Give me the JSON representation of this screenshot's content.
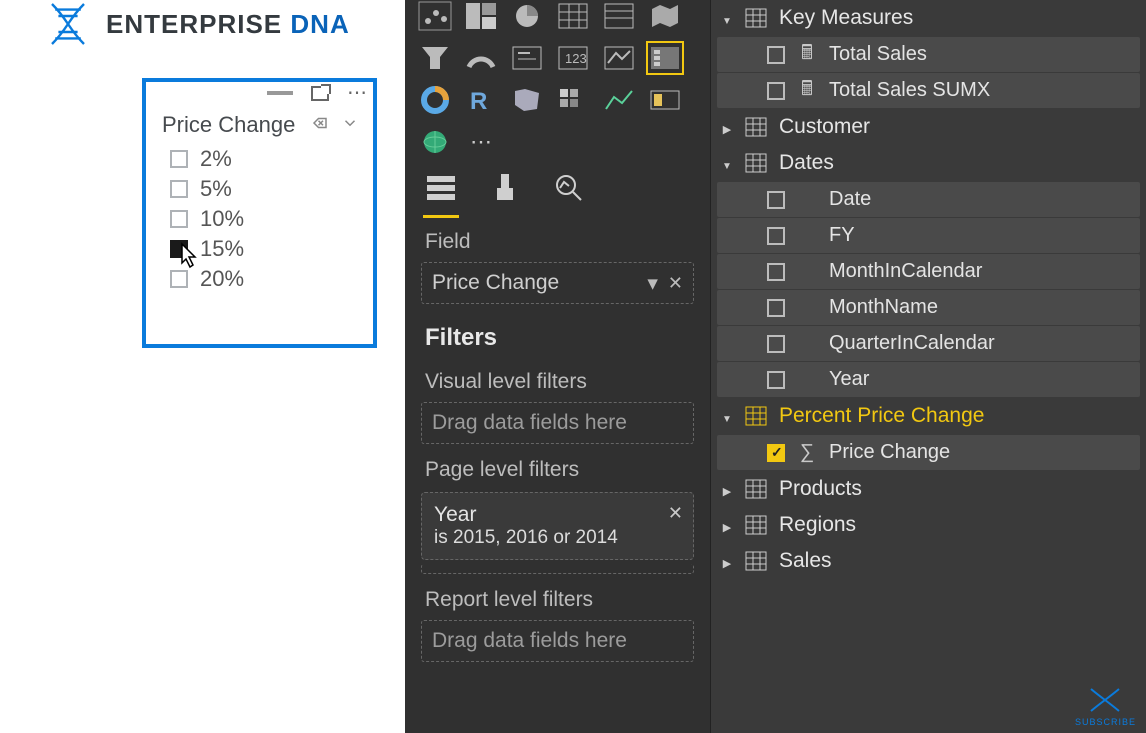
{
  "logo": {
    "line1": "ENTERPRISE",
    "line2": "DNA"
  },
  "slicer": {
    "title": "Price Change",
    "options": [
      "2%",
      "5%",
      "10%",
      "15%",
      "20%"
    ],
    "selected_index": 3
  },
  "viz_pane": {
    "field_label": "Field",
    "field_value": "Price Change",
    "filters_label": "Filters",
    "visual_filters_label": "Visual level filters",
    "visual_filters_placeholder": "Drag data fields here",
    "page_filters_label": "Page level filters",
    "page_filter_name": "Year",
    "page_filter_desc": "is 2015, 2016 or 2014",
    "report_filters_label": "Report level filters",
    "report_filters_placeholder": "Drag data fields here"
  },
  "fields": {
    "key_measures": {
      "label": "Key Measures",
      "items": [
        "Total Sales",
        "Total Sales SUMX"
      ]
    },
    "customer": {
      "label": "Customer"
    },
    "dates": {
      "label": "Dates",
      "items": [
        "Date",
        "FY",
        "MonthInCalendar",
        "MonthName",
        "QuarterInCalendar",
        "Year"
      ]
    },
    "ppc": {
      "label": "Percent Price Change",
      "item": "Price Change"
    },
    "products": {
      "label": "Products"
    },
    "regions": {
      "label": "Regions"
    },
    "sales": {
      "label": "Sales"
    }
  },
  "subscribe": "SUBSCRIBE"
}
